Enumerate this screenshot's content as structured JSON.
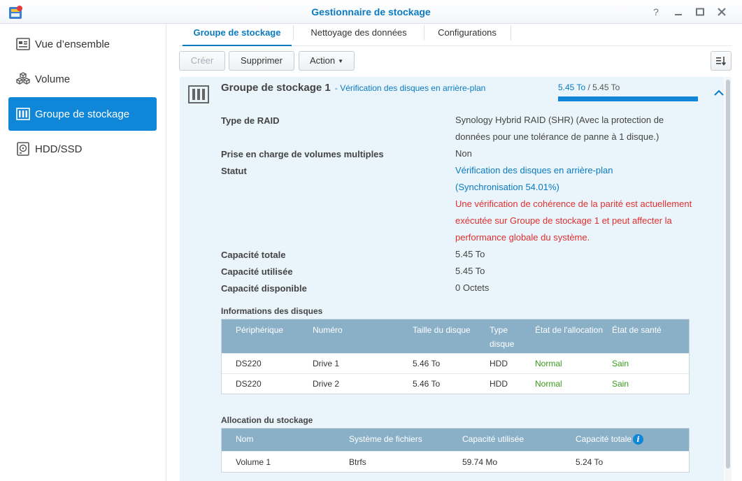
{
  "window": {
    "title": "Gestionnaire de stockage"
  },
  "sidebar": {
    "items": [
      {
        "label": "Vue d’ensemble",
        "icon": "overview-icon"
      },
      {
        "label": "Volume",
        "icon": "volume-cubes-icon"
      },
      {
        "label": "Groupe de stockage",
        "icon": "storage-pool-icon",
        "active": true
      },
      {
        "label": "HDD/SSD",
        "icon": "hdd-icon"
      }
    ]
  },
  "tabs": [
    "Groupe de stockage",
    "Nettoyage des données",
    "Configurations"
  ],
  "toolbar": {
    "create": "Créer",
    "delete": "Supprimer",
    "action": "Action"
  },
  "pool": {
    "title": "Groupe de stockage 1",
    "status_inline": "- Vérification des disques en arrière-plan",
    "capacity_used": "5.45 To",
    "capacity_sep": " / ",
    "capacity_total": "5.45 To",
    "capacity_fraction": 1.0,
    "details": {
      "raid_label": "Type de RAID",
      "raid_value": "Synology Hybrid RAID (SHR) (Avec la protection de données pour une tolérance de panne à 1 disque.)",
      "multi_label": "Prise en charge de volumes multiples",
      "multi_value": "Non",
      "status_label": "Statut",
      "status_line1": "Vérification des disques en arrière-plan",
      "status_line2": "(Synchronisation 54.01%)",
      "status_warning": "Une vérification de cohérence de la parité est actuellement exécutée sur Groupe de stockage 1 et peut affecter la performance globale du système.",
      "total_label": "Capacité totale",
      "total_value": "5.45 To",
      "used_label": "Capacité utilisée",
      "used_value": "5.45 To",
      "avail_label": "Capacité disponible",
      "avail_value": "0 Octets"
    }
  },
  "disks": {
    "section_title": "Informations des disques",
    "headers": [
      "Périphérique",
      "Numéro",
      "Taille du disque",
      "Type disque",
      "État de l'allocation",
      "État de santé"
    ],
    "rows": [
      [
        "DS220",
        "Drive 1",
        "5.46 To",
        "HDD",
        "Normal",
        "Sain"
      ],
      [
        "DS220",
        "Drive 2",
        "5.46 To",
        "HDD",
        "Normal",
        "Sain"
      ]
    ]
  },
  "allocation": {
    "section_title": "Allocation du stockage",
    "headers": [
      "Nom",
      "Système de fichiers",
      "Capacité utilisée",
      "Capacité totale"
    ],
    "rows": [
      [
        "Volume 1",
        "Btrfs",
        "59.74 Mo",
        "5.24 To"
      ]
    ]
  },
  "colors": {
    "accent": "#0f86d8",
    "link": "#0a7bc1",
    "warning": "#e0302e",
    "ok": "#3a9b1e",
    "grid_header": "#8ab0c8"
  }
}
